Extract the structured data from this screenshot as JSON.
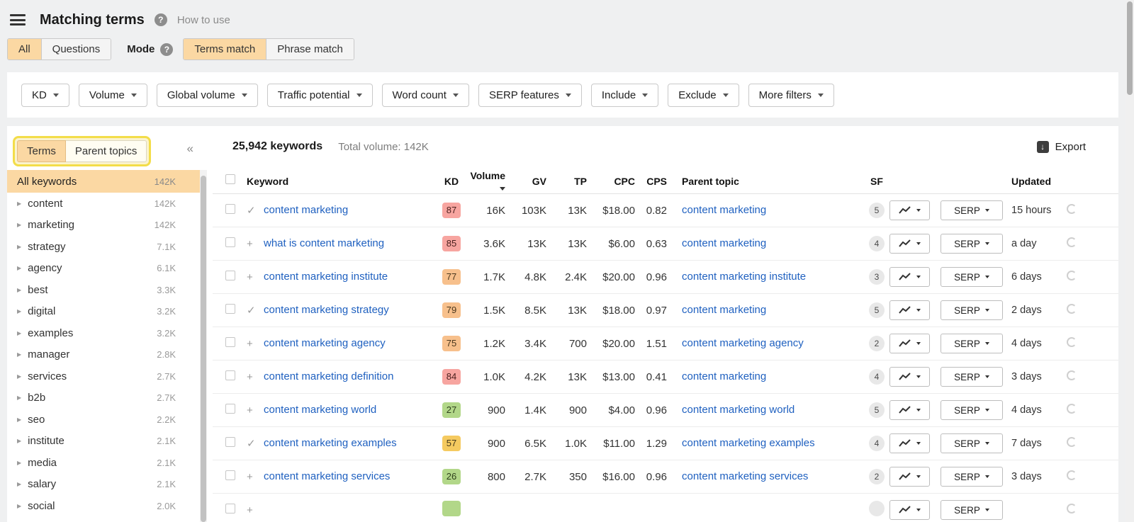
{
  "header": {
    "title": "Matching terms",
    "help_label": "How to use"
  },
  "mode_bar": {
    "scope_tabs": [
      {
        "label": "All",
        "selected": true
      },
      {
        "label": "Questions",
        "selected": false
      }
    ],
    "mode_label": "Mode",
    "match_tabs": [
      {
        "label": "Terms match",
        "selected": true
      },
      {
        "label": "Phrase match",
        "selected": false
      }
    ]
  },
  "filters": [
    "KD",
    "Volume",
    "Global volume",
    "Traffic potential",
    "Word count",
    "SERP features",
    "Include",
    "Exclude",
    "More filters"
  ],
  "sidebar": {
    "tabs": [
      {
        "label": "Terms",
        "selected": true
      },
      {
        "label": "Parent topics",
        "selected": false
      }
    ],
    "collapse_icon": "«",
    "all_row": {
      "label": "All keywords",
      "count": "142K"
    },
    "items": [
      {
        "label": "content",
        "count": "142K"
      },
      {
        "label": "marketing",
        "count": "142K"
      },
      {
        "label": "strategy",
        "count": "7.1K"
      },
      {
        "label": "agency",
        "count": "6.1K"
      },
      {
        "label": "best",
        "count": "3.3K"
      },
      {
        "label": "digital",
        "count": "3.2K"
      },
      {
        "label": "examples",
        "count": "3.2K"
      },
      {
        "label": "manager",
        "count": "2.8K"
      },
      {
        "label": "services",
        "count": "2.7K"
      },
      {
        "label": "b2b",
        "count": "2.7K"
      },
      {
        "label": "seo",
        "count": "2.2K"
      },
      {
        "label": "institute",
        "count": "2.1K"
      },
      {
        "label": "media",
        "count": "2.1K"
      },
      {
        "label": "salary",
        "count": "2.1K"
      },
      {
        "label": "social",
        "count": "2.0K"
      }
    ]
  },
  "toolbar": {
    "keywords_count": "25,942 keywords",
    "total_volume": "Total volume: 142K",
    "export_label": "Export"
  },
  "table": {
    "columns": {
      "keyword": "Keyword",
      "kd": "KD",
      "volume": "Volume",
      "gv": "GV",
      "tp": "TP",
      "cpc": "CPC",
      "cps": "CPS",
      "parent": "Parent topic",
      "sf": "SF",
      "updated": "Updated"
    },
    "serp_button_label": "SERP",
    "rows": [
      {
        "icon": "check",
        "keyword": "content marketing",
        "kd": "87",
        "kd_color": "red",
        "volume": "16K",
        "gv": "103K",
        "tp": "13K",
        "cpc": "$18.00",
        "cps": "0.82",
        "parent": "content marketing",
        "sf": "5",
        "updated": "15 hours"
      },
      {
        "icon": "plus",
        "keyword": "what is content marketing",
        "kd": "85",
        "kd_color": "red",
        "volume": "3.6K",
        "gv": "13K",
        "tp": "13K",
        "cpc": "$6.00",
        "cps": "0.63",
        "parent": "content marketing",
        "sf": "4",
        "updated": "a day"
      },
      {
        "icon": "plus",
        "keyword": "content marketing institute",
        "kd": "77",
        "kd_color": "orange",
        "volume": "1.7K",
        "gv": "4.8K",
        "tp": "2.4K",
        "cpc": "$20.00",
        "cps": "0.96",
        "parent": "content marketing institute",
        "sf": "3",
        "updated": "6 days"
      },
      {
        "icon": "check",
        "keyword": "content marketing strategy",
        "kd": "79",
        "kd_color": "orange",
        "volume": "1.5K",
        "gv": "8.5K",
        "tp": "13K",
        "cpc": "$18.00",
        "cps": "0.97",
        "parent": "content marketing",
        "sf": "5",
        "updated": "2 days"
      },
      {
        "icon": "plus",
        "keyword": "content marketing agency",
        "kd": "75",
        "kd_color": "orange",
        "volume": "1.2K",
        "gv": "3.4K",
        "tp": "700",
        "cpc": "$20.00",
        "cps": "1.51",
        "parent": "content marketing agency",
        "sf": "2",
        "updated": "4 days"
      },
      {
        "icon": "plus",
        "keyword": "content marketing definition",
        "kd": "84",
        "kd_color": "red",
        "volume": "1.0K",
        "gv": "4.2K",
        "tp": "13K",
        "cpc": "$13.00",
        "cps": "0.41",
        "parent": "content marketing",
        "sf": "4",
        "updated": "3 days"
      },
      {
        "icon": "plus",
        "keyword": "content marketing world",
        "kd": "27",
        "kd_color": "green",
        "volume": "900",
        "gv": "1.4K",
        "tp": "900",
        "cpc": "$4.00",
        "cps": "0.96",
        "parent": "content marketing world",
        "sf": "5",
        "updated": "4 days"
      },
      {
        "icon": "check",
        "keyword": "content marketing examples",
        "kd": "57",
        "kd_color": "yellow",
        "volume": "900",
        "gv": "6.5K",
        "tp": "1.0K",
        "cpc": "$11.00",
        "cps": "1.29",
        "parent": "content marketing examples",
        "sf": "4",
        "updated": "7 days"
      },
      {
        "icon": "plus",
        "keyword": "content marketing services",
        "kd": "26",
        "kd_color": "green",
        "volume": "800",
        "gv": "2.7K",
        "tp": "350",
        "cpc": "$16.00",
        "cps": "0.96",
        "parent": "content marketing services",
        "sf": "2",
        "updated": "3 days"
      },
      {
        "icon": "plus",
        "keyword": "",
        "kd": "",
        "kd_color": "green",
        "volume": "",
        "gv": "",
        "tp": "",
        "cpc": "",
        "cps": "",
        "parent": "",
        "sf": "",
        "updated": "",
        "partial": true
      }
    ]
  },
  "colors": {
    "accent_orange": "#fbd8a3",
    "highlight_yellow": "#f3dd49",
    "kd_red": "#f7a5a0",
    "kd_orange": "#f7c08c",
    "kd_yellow": "#f5ca60",
    "kd_green": "#b2d789",
    "link_blue": "#2061c0"
  }
}
